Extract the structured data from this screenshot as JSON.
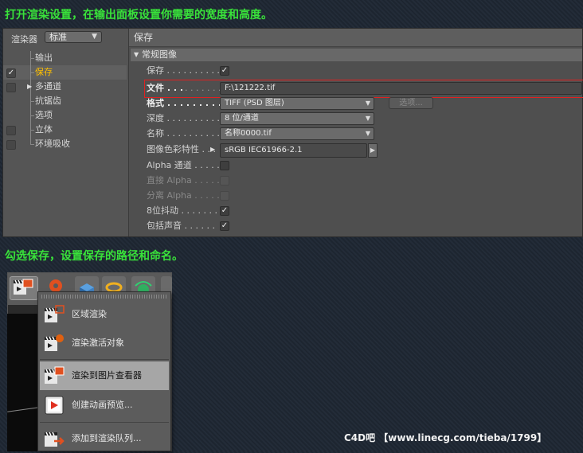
{
  "captions": {
    "top": "打开渲染设置，在输出面板设置你需要的宽度和高度。",
    "middle": "勾选保存，设置保存的路径和命名。"
  },
  "render_settings": {
    "renderer_label": "渲染器",
    "renderer_value": "标准",
    "tree": [
      {
        "label": "输出",
        "checkbox": "none",
        "active": false
      },
      {
        "label": "保存",
        "checkbox": "checked",
        "active": true
      },
      {
        "label": "多通道",
        "checkbox": "unchecked",
        "active": false,
        "expandable": true
      },
      {
        "label": "抗锯齿",
        "checkbox": "none",
        "active": false
      },
      {
        "label": "选项",
        "checkbox": "none",
        "active": false
      },
      {
        "label": "立体",
        "checkbox": "unchecked",
        "active": false
      },
      {
        "label": "环境吸收",
        "checkbox": "unchecked",
        "active": false
      }
    ],
    "panel_title": "保存",
    "section_title": "常规图像",
    "fields": {
      "save_label": "保存 . . . . . . . . . .",
      "save_checked": true,
      "file_label": "文件 . . .",
      "file_dots": ". . . . . . . . .",
      "file_value": "F:\\121222.tif",
      "format_label": "格式 . . . . . . . . . .",
      "format_value": "TIFF (PSD 图层)",
      "options_label": "选项...",
      "depth_label": "深度 . . . . . . . . . .",
      "depth_value": "8 位/通道",
      "name_label": "名称 . . . . . . . . . .",
      "name_value": "名称0000.tif",
      "profile_label": "图像色彩特性 . . .",
      "profile_value": "sRGB IEC61966-2.1",
      "alpha_label": "Alpha 通道 . . . . .",
      "alpha_checked": false,
      "straight_alpha_label": "直接 Alpha . . . . .",
      "straight_alpha_checked": false,
      "separate_alpha_label": "分离 Alpha . . . . .",
      "separate_alpha_checked": false,
      "dither_label": "8位抖动 . . . . . . .",
      "dither_checked": true,
      "sound_label": "包括声音 . . . . . .",
      "sound_checked": true
    }
  },
  "render_menu": {
    "items": [
      {
        "label": "区域渲染",
        "icon": "region-render-icon"
      },
      {
        "label": "渲染激活对象",
        "icon": "render-active-object-icon"
      },
      {
        "label": "渲染到图片查看器",
        "icon": "render-to-picture-viewer-icon",
        "highlighted": true
      },
      {
        "label": "创建动画预览...",
        "icon": "make-preview-icon"
      },
      {
        "label": "添加到渲染队列...",
        "icon": "add-to-render-queue-icon"
      }
    ]
  },
  "watermark": "C4D吧 【www.linecg.com/tieba/1799】",
  "colors": {
    "caption": "#39e23a",
    "active_tree_item": "#ffc000",
    "file_highlight": "#e02020"
  }
}
